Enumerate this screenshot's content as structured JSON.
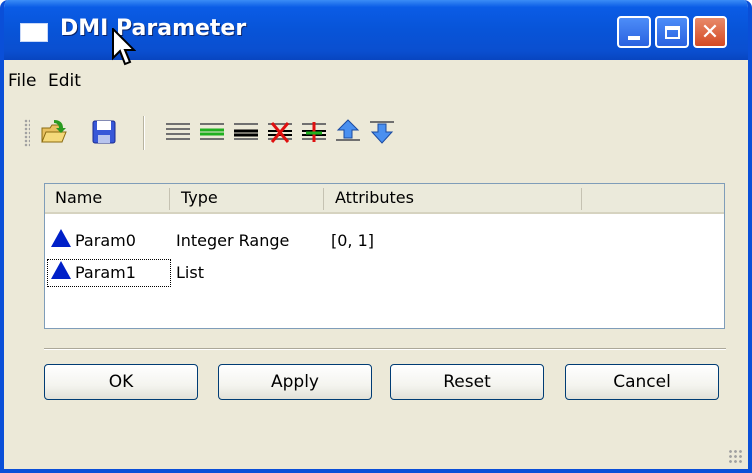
{
  "window": {
    "title": "DMI Parameter"
  },
  "menu": {
    "file": "File",
    "edit": "Edit"
  },
  "toolbar": {
    "icons": [
      "open-icon",
      "save-icon",
      "align-left-icon",
      "add-row-icon",
      "insert-row-icon",
      "delete-row-icon",
      "plus-row-icon",
      "move-up-icon",
      "move-down-icon"
    ]
  },
  "table": {
    "columns": [
      "Name",
      "Type",
      "Attributes"
    ],
    "rows": [
      {
        "name": "Param0",
        "type": "Integer Range",
        "attributes": "[0, 1]"
      },
      {
        "name": "Param1",
        "type": "List",
        "attributes": ""
      }
    ]
  },
  "buttons": {
    "ok": "OK",
    "apply": "Apply",
    "reset": "Reset",
    "cancel": "Cancel"
  },
  "colors": {
    "titlebar": "#0a5ce6",
    "dialog": "#ece9d8",
    "param_icon": "#0020c8"
  }
}
